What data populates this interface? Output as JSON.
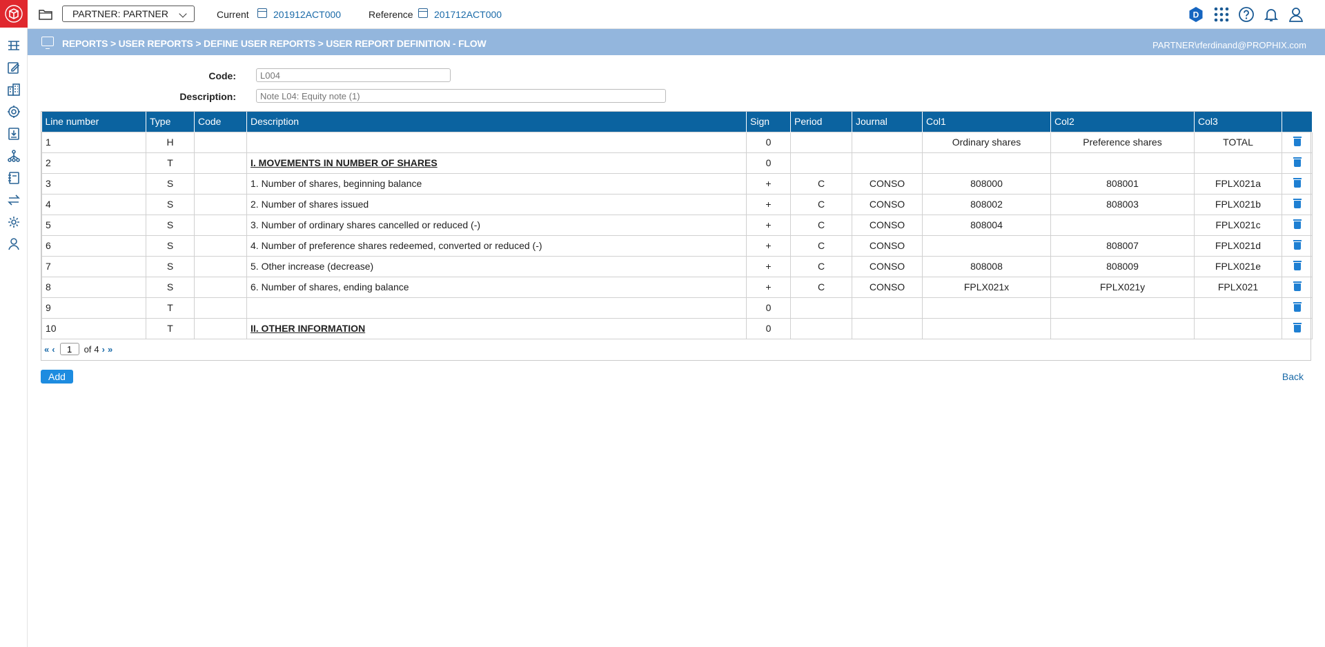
{
  "topbar": {
    "partner_value": "PARTNER: PARTNER",
    "current_label": "Current",
    "current_value": "201912ACT000",
    "reference_label": "Reference",
    "reference_value": "201712ACT000",
    "avatar_letter": "D",
    "icons": [
      "folder-icon",
      "apps-grid-icon",
      "help-icon",
      "bell-icon",
      "user-icon"
    ]
  },
  "breadcrumb": {
    "path": "REPORTS > USER REPORTS > DEFINE USER REPORTS > USER REPORT DEFINITION - FLOW",
    "user": "PARTNER\\rferdinand@PROPHIX.com"
  },
  "form": {
    "code_label": "Code:",
    "code_placeholder": "L004",
    "description_label": "Description:",
    "description_placeholder": "Note L04: Equity note (1)"
  },
  "table": {
    "headers": [
      "Line number",
      "Type",
      "Code",
      "Description",
      "Sign",
      "Period",
      "Journal",
      "Col1",
      "Col2",
      "Col3",
      ""
    ],
    "rows": [
      {
        "line": "1",
        "type": "H",
        "code": "",
        "desc": "",
        "title": false,
        "sign": "0",
        "period": "",
        "journal": "",
        "col1": "Ordinary shares",
        "col2": "Preference shares",
        "col3": "TOTAL"
      },
      {
        "line": "2",
        "type": "T",
        "code": "",
        "desc": "I. MOVEMENTS IN NUMBER OF SHARES",
        "title": true,
        "sign": "0",
        "period": "",
        "journal": "",
        "col1": "",
        "col2": "",
        "col3": ""
      },
      {
        "line": "3",
        "type": "S",
        "code": "",
        "desc": "1. Number of shares, beginning balance",
        "title": false,
        "sign": "+",
        "period": "C",
        "journal": "CONSO",
        "col1": "808000",
        "col2": "808001",
        "col3": "FPLX021a"
      },
      {
        "line": "4",
        "type": "S",
        "code": "",
        "desc": "2. Number of shares issued",
        "title": false,
        "sign": "+",
        "period": "C",
        "journal": "CONSO",
        "col1": "808002",
        "col2": "808003",
        "col3": "FPLX021b"
      },
      {
        "line": "5",
        "type": "S",
        "code": "",
        "desc": "3. Number of ordinary shares cancelled or reduced (-)",
        "title": false,
        "sign": "+",
        "period": "C",
        "journal": "CONSO",
        "col1": "808004",
        "col2": "",
        "col3": "FPLX021c"
      },
      {
        "line": "6",
        "type": "S",
        "code": "",
        "desc": "4. Number of preference shares redeemed, converted or reduced (-)",
        "title": false,
        "sign": "+",
        "period": "C",
        "journal": "CONSO",
        "col1": "",
        "col2": "808007",
        "col3": "FPLX021d"
      },
      {
        "line": "7",
        "type": "S",
        "code": "",
        "desc": "5. Other increase (decrease)",
        "title": false,
        "sign": "+",
        "period": "C",
        "journal": "CONSO",
        "col1": "808008",
        "col2": "808009",
        "col3": "FPLX021e"
      },
      {
        "line": "8",
        "type": "S",
        "code": "",
        "desc": "6. Number of shares, ending balance",
        "title": false,
        "sign": "+",
        "period": "C",
        "journal": "CONSO",
        "col1": "FPLX021x",
        "col2": "FPLX021y",
        "col3": "FPLX021"
      },
      {
        "line": "9",
        "type": "T",
        "code": "",
        "desc": "",
        "title": false,
        "sign": "0",
        "period": "",
        "journal": "",
        "col1": "",
        "col2": "",
        "col3": ""
      },
      {
        "line": "10",
        "type": "T",
        "code": "",
        "desc": "II. OTHER INFORMATION",
        "title": true,
        "sign": "0",
        "period": "",
        "journal": "",
        "col1": "",
        "col2": "",
        "col3": ""
      }
    ]
  },
  "pager": {
    "first": "«",
    "prev": "‹",
    "current_page": "1",
    "of_label": "of",
    "total_pages": "4",
    "next": "›",
    "last": "»"
  },
  "actions": {
    "add_label": "Add",
    "back_label": "Back"
  },
  "colors": {
    "brand_red": "#e0282e",
    "header_blue": "#0b63a0",
    "band_blue": "#93b6dd",
    "link_blue": "#1a6aa8",
    "button_blue": "#1d8ce0"
  }
}
